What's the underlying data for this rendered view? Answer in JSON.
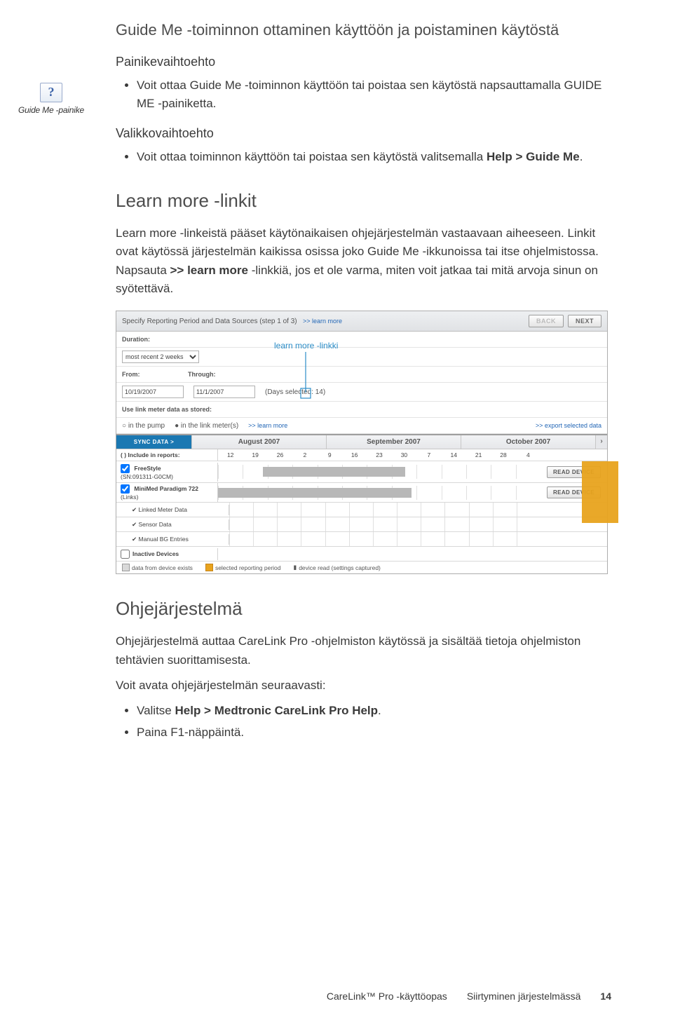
{
  "section1": {
    "title": "Guide Me -toiminnon ottaminen käyttöön ja poistaminen käytöstä",
    "side_icon_glyph": "?",
    "side_label": "Guide Me -painike",
    "sub1": "Painikevaihtoehto",
    "bullet1_a": "Voit ottaa Guide Me -toiminnon käyttöön tai poistaa sen käytöstä napsauttamalla GUIDE ME -painiketta.",
    "sub2": "Valikkovaihtoehto",
    "bullet2_a_pre": "Voit ottaa toiminnon käyttöön tai poistaa sen käytöstä valitsemalla ",
    "bullet2_a_bold": "Help > Guide Me",
    "bullet2_a_post": "."
  },
  "section2": {
    "title": "Learn more -linkit",
    "p1_pre": "Learn more -linkeistä pääset käytönaikaisen ohjejärjestelmän vastaavaan aiheeseen. Linkit ovat käytössä järjestelmän kaikissa osissa joko Guide Me -ikkunoissa tai itse ohjelmistossa. Napsauta ",
    "p1_bold": ">> learn more",
    "p1_post": " -linkkiä, jos et ole varma, miten voit jatkaa tai mitä arvoja sinun on syötettävä."
  },
  "shot": {
    "annotation": "learn more -linkki",
    "title": "Specify Reporting Period and Data Sources (step 1 of 3)",
    "title_link": ">> learn more",
    "back": "BACK",
    "next": "NEXT",
    "duration_label": "Duration:",
    "duration_value": "most recent 2 weeks",
    "from_label": "From:",
    "from_value": "10/19/2007",
    "through_label": "Through:",
    "through_value": "11/1/2007",
    "days_selected": "(Days selected: 14)",
    "use_link_label": "Use link meter data as stored:",
    "use_opt_a": "in the pump",
    "use_opt_b": "in the link meter(s)",
    "use_link": ">> learn more",
    "export_link": ">> export selected data",
    "sync_btn": "SYNC DATA  >",
    "months": [
      "August 2007",
      "September 2007",
      "October 2007"
    ],
    "include_label": "(  ) Include in reports:",
    "day_numbers": [
      "12",
      "19",
      "26",
      "2",
      "9",
      "16",
      "23",
      "30",
      "7",
      "14",
      "21",
      "28",
      "4"
    ],
    "dev1_name": "FreeStyle",
    "dev1_sn": "(SN:091311-G0CM)",
    "dev2_name": "MiniMed Paradigm 722",
    "dev2_sn": "(Links)",
    "dev2_a": "Linked Meter Data",
    "dev2_b": "Sensor Data",
    "dev2_c": "Manual BG Entries",
    "dev3_name": "Inactive Devices",
    "read_device": "READ DEVICE",
    "legend_a": "data from device exists",
    "legend_b": "selected reporting period",
    "legend_c": "device read (settings captured)"
  },
  "section3": {
    "title": "Ohjejärjestelmä",
    "p1": "Ohjejärjestelmä auttaa CareLink Pro -ohjelmiston käytössä ja sisältää tietoja ohjelmiston tehtävien suorittamisesta.",
    "p2": "Voit avata ohjejärjestelmän seuraavasti:",
    "bullet1_pre": "Valitse ",
    "bullet1_bold": "Help > Medtronic CareLink Pro Help",
    "bullet1_post": ".",
    "bullet2": "Paina F1-näppäintä."
  },
  "footer": {
    "left": "CareLink™ Pro -käyttöopas",
    "center": "Siirtyminen järjestelmässä",
    "page": "14"
  }
}
